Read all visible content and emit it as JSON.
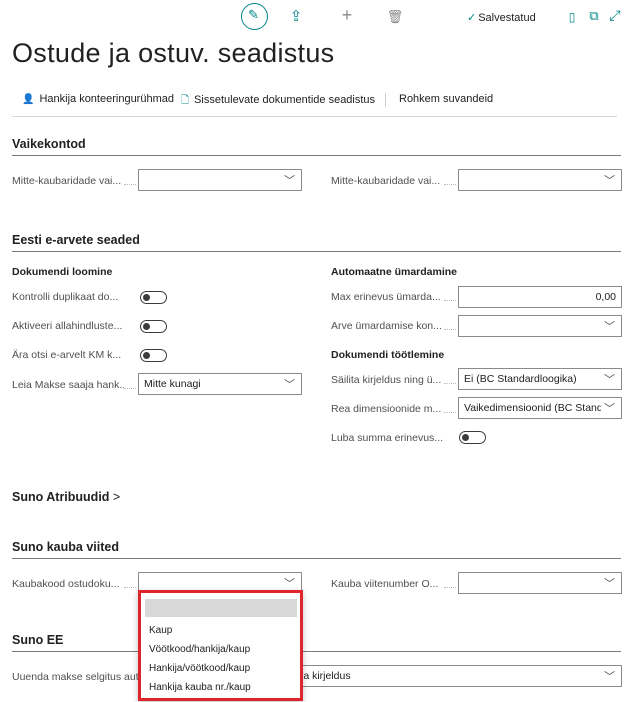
{
  "toolbar": {
    "saved_label": "Salvestatud"
  },
  "page": {
    "title": "Ostude ja ostuv. seadistus"
  },
  "actions": {
    "items": [
      "Hankija konteeringurühmad",
      "Sissetulevate dokumentide seadistus",
      "Rohkem suvandeid"
    ]
  },
  "sections": {
    "vaikekontod": {
      "title": "Vaikekontod",
      "field1_label": "Mitte-kaubaridade vai...",
      "field1_value": "",
      "field2_label": "Mitte-kaubaridade vai...",
      "field2_value": ""
    },
    "earve": {
      "title": "Eesti e-arvete seaded",
      "left_group": "Dokumendi loomine",
      "l1": "Kontrolli duplikaat do...",
      "l2": "Aktiveeri allahindluste...",
      "l3": "Ära otsi e-arvelt KM k...",
      "l4": "Leia Makse saaja hank...",
      "l4_value": "Mitte kunagi",
      "right_group1": "Automaatne ümardamine",
      "r1": "Max erinevus ümarda...",
      "r1_value": "0,00",
      "r2": "Arve ümardamise kon...",
      "r2_value": "",
      "right_group2": "Dokumendi töötlemine",
      "r3": "Säilita kirjeldus ning ü...",
      "r3_value": "Ei (BC Standardloogika)",
      "r4": "Rea dimensioonide m...",
      "r4_value": "Vaikedimensioonid (BC Standard",
      "r5": "Luba summa erinevus..."
    },
    "atribuudid": {
      "title": "Suno Atribuudid",
      "chevron": ">"
    },
    "kauba_viited": {
      "title": "Suno kauba viited",
      "f1_label": "Kaubakood ostudoku...",
      "f1_value": "",
      "f2_label": "Kauba viitenumber O...",
      "f2_value": ""
    },
    "ee": {
      "title": "Suno EE",
      "f1_label": "Uuenda makse selgitus aut",
      "f1_value": "ja kirjeldus"
    }
  },
  "dropdown": {
    "options": [
      "",
      "Kaup",
      "Vöötkood/hankija/kaup",
      "Hankija/vöötkood/kaup",
      "Hankija kauba nr./kaup"
    ],
    "highlight_color": "#e0242c"
  },
  "colors": {
    "accent": "#008489",
    "text": "#212121"
  }
}
